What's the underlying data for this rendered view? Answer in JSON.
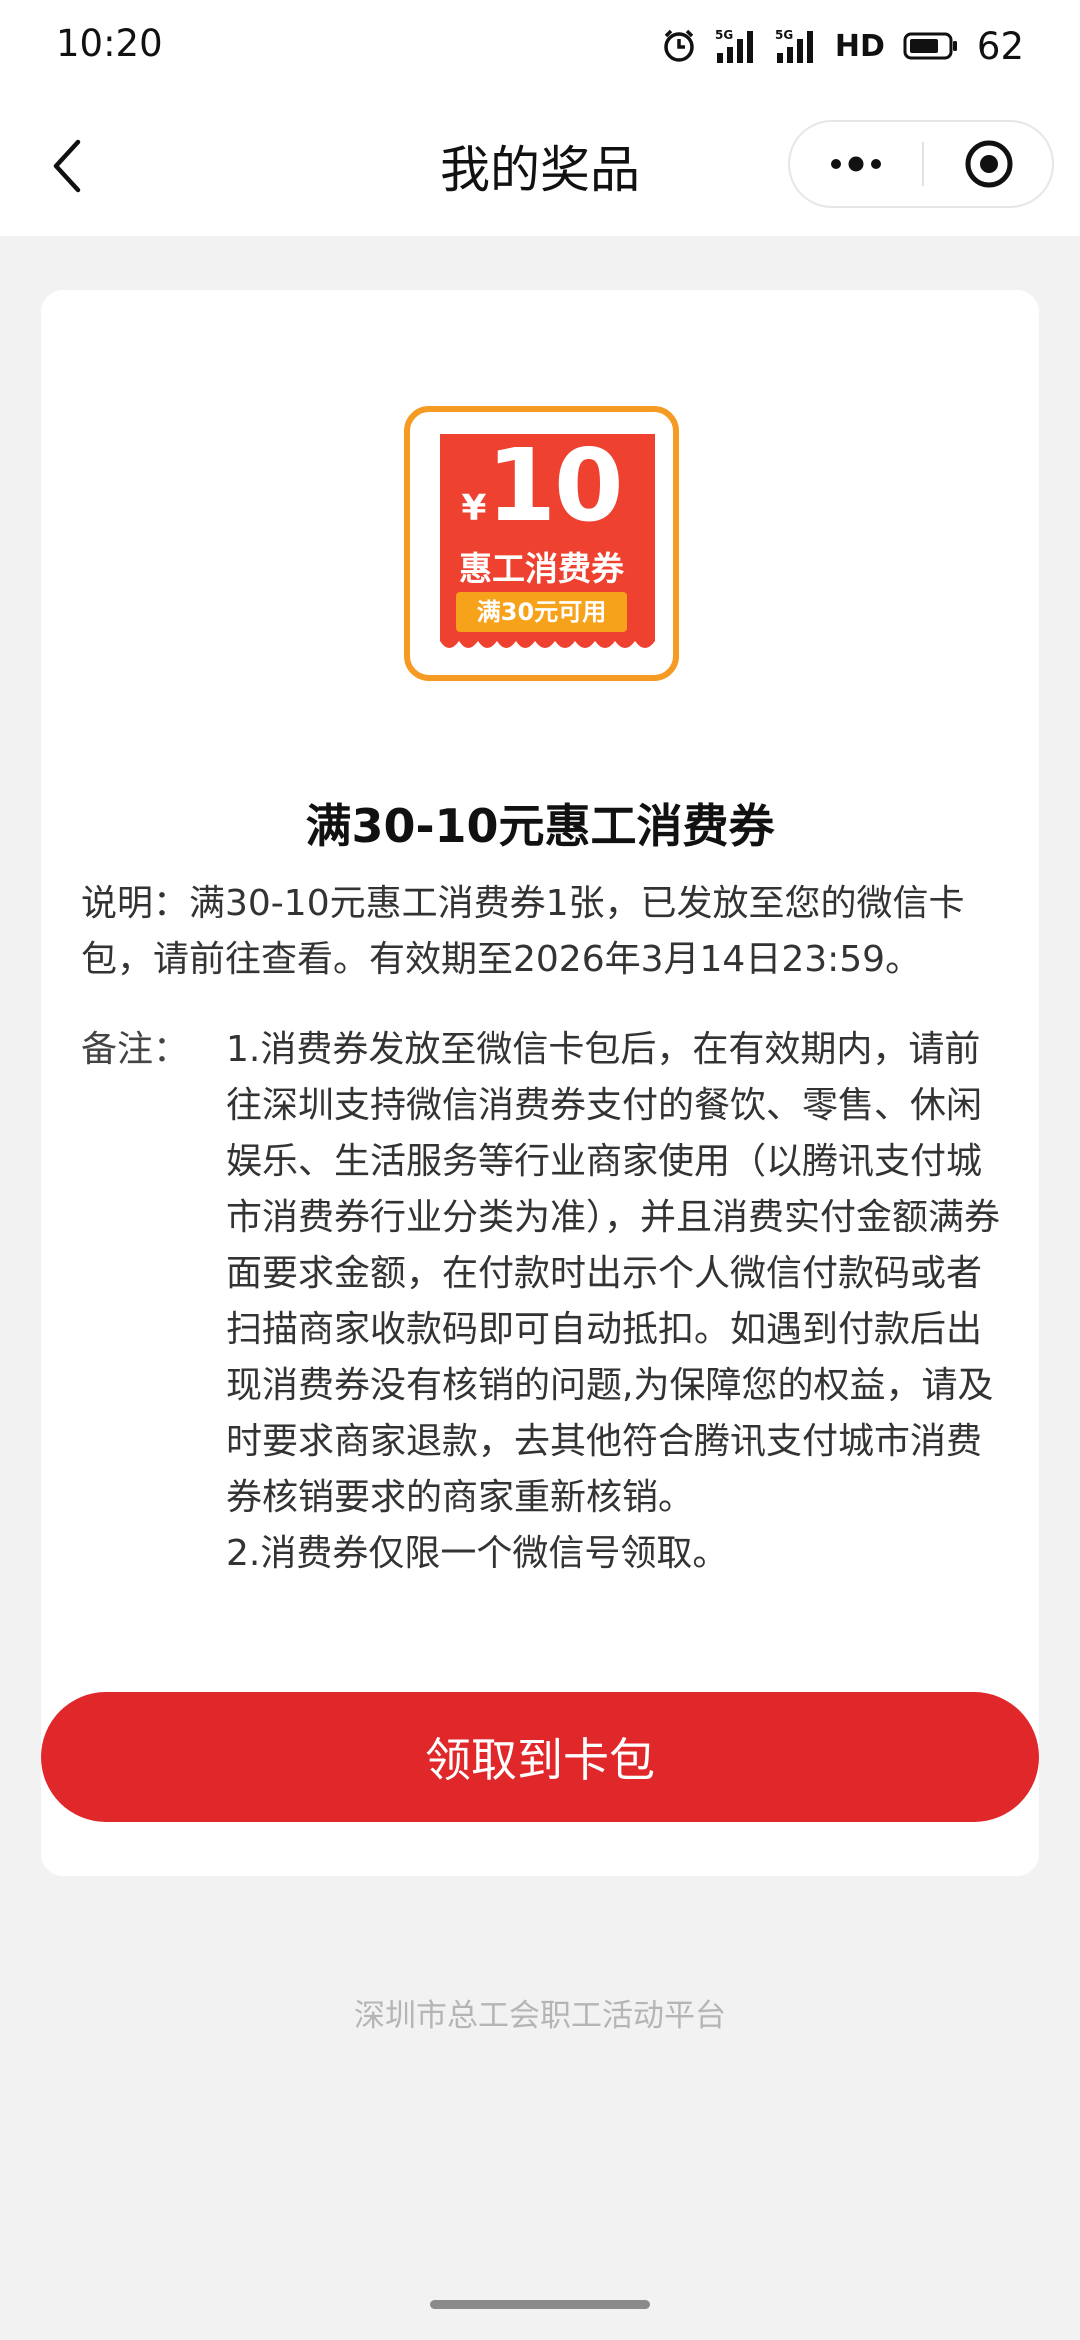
{
  "status_bar": {
    "time": "10:20",
    "hd_label": "HD",
    "battery": "62",
    "icons": [
      "alarm-icon",
      "signal-5g-icon",
      "signal-5g-icon",
      "battery-icon"
    ]
  },
  "nav": {
    "title": "我的奖品",
    "back_icon": "chevron-left-icon",
    "more_icon": "more-dots-icon",
    "close_icon": "target-close-icon"
  },
  "coupon": {
    "currency": "¥",
    "amount": "10",
    "name": "惠工消费券",
    "condition": "满30元可用",
    "colors": {
      "border": "#f59a22",
      "face": "#ee4130",
      "condition_bg": "#f7a21b",
      "text": "#ffffff"
    }
  },
  "prize": {
    "title": "满30-10元惠工消费券",
    "description": "说明：满30-10元惠工消费券1张，已发放至您的微信卡包，请前往查看。有效期至2026年3月14日23:59。",
    "note_label": "备注：",
    "note_lines": [
      "1.消费券发放至微信卡包后，在有效期内，请前往深圳支持微信消费券支付的餐饮、零售、休闲娱乐、生活服务等行业商家使用（以腾讯支付城市消费券行业分类为准），并且消费实付金额满券面要求金额，在付款时出示个人微信付款码或者扫描商家收款码即可自动抵扣。如遇到付款后出现消费券没有核销的问题,为保障您的权益，请及时要求商家退款，去其他符合腾讯支付城市消费券核销要求的商家重新核销。",
      "2.消费券仅限一个微信号领取。"
    ]
  },
  "actions": {
    "claim_label": "领取到卡包",
    "claim_color": "#e0272a"
  },
  "footer": {
    "text": "深圳市总工会职工活动平台"
  }
}
